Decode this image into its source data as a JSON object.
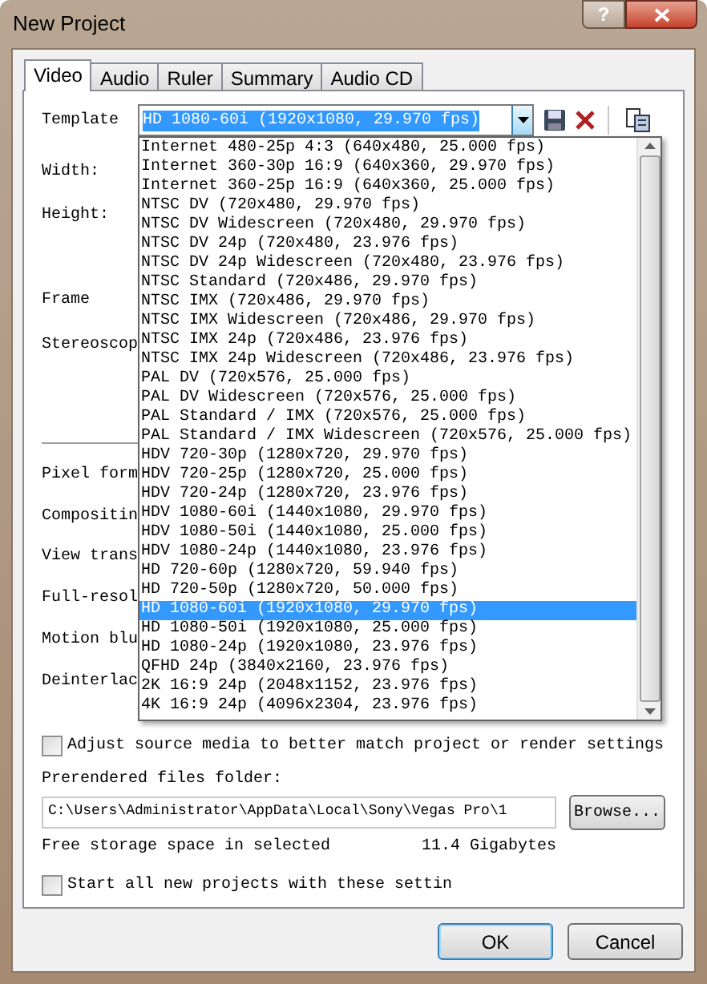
{
  "window": {
    "title": "New Project",
    "help": "?"
  },
  "tabs": [
    {
      "label": "Video",
      "selected": true
    },
    {
      "label": "Audio",
      "selected": false
    },
    {
      "label": "Ruler",
      "selected": false
    },
    {
      "label": "Summary",
      "selected": false
    },
    {
      "label": "Audio CD",
      "selected": false
    }
  ],
  "template": {
    "label": "Template",
    "value": "HD 1080-60i (1920x1080, 29.970 fps)"
  },
  "form_labels": [
    "Width:",
    "Height:",
    "Frame",
    "Stereoscop",
    "Pixel form",
    "Compositin",
    "View trans",
    "Full-resol",
    "Motion blu",
    "Deinterlac"
  ],
  "dropdown_items": [
    {
      "label": "Internet 480-25p 4:3 (640x480, 25.000 fps)",
      "selected": false
    },
    {
      "label": "Internet 360-30p 16:9 (640x360, 29.970 fps)",
      "selected": false
    },
    {
      "label": "Internet 360-25p 16:9 (640x360, 25.000 fps)",
      "selected": false
    },
    {
      "label": "NTSC DV (720x480, 29.970 fps)",
      "selected": false
    },
    {
      "label": "NTSC DV Widescreen (720x480, 29.970 fps)",
      "selected": false
    },
    {
      "label": "NTSC DV 24p (720x480, 23.976 fps)",
      "selected": false
    },
    {
      "label": "NTSC DV 24p Widescreen (720x480, 23.976 fps)",
      "selected": false
    },
    {
      "label": "NTSC Standard (720x486, 29.970 fps)",
      "selected": false
    },
    {
      "label": "NTSC IMX (720x486, 29.970 fps)",
      "selected": false
    },
    {
      "label": "NTSC IMX Widescreen (720x486, 29.970 fps)",
      "selected": false
    },
    {
      "label": "NTSC IMX 24p (720x486, 23.976 fps)",
      "selected": false
    },
    {
      "label": "NTSC IMX 24p Widescreen (720x486, 23.976 fps)",
      "selected": false
    },
    {
      "label": "PAL DV (720x576, 25.000 fps)",
      "selected": false
    },
    {
      "label": "PAL DV Widescreen (720x576, 25.000 fps)",
      "selected": false
    },
    {
      "label": "PAL Standard / IMX (720x576, 25.000 fps)",
      "selected": false
    },
    {
      "label": "PAL Standard / IMX Widescreen (720x576, 25.000 fps)",
      "selected": false
    },
    {
      "label": "HDV 720-30p (1280x720, 29.970 fps)",
      "selected": false
    },
    {
      "label": "HDV 720-25p (1280x720, 25.000 fps)",
      "selected": false
    },
    {
      "label": "HDV 720-24p (1280x720, 23.976 fps)",
      "selected": false
    },
    {
      "label": "HDV 1080-60i (1440x1080, 29.970 fps)",
      "selected": false
    },
    {
      "label": "HDV 1080-50i (1440x1080, 25.000 fps)",
      "selected": false
    },
    {
      "label": "HDV 1080-24p (1440x1080, 23.976 fps)",
      "selected": false
    },
    {
      "label": "HD 720-60p (1280x720, 59.940 fps)",
      "selected": false
    },
    {
      "label": "HD 720-50p (1280x720, 50.000 fps)",
      "selected": false
    },
    {
      "label": "HD 1080-60i (1920x1080, 29.970 fps)",
      "selected": true
    },
    {
      "label": "HD 1080-50i (1920x1080, 25.000 fps)",
      "selected": false
    },
    {
      "label": "HD 1080-24p (1920x1080, 23.976 fps)",
      "selected": false
    },
    {
      "label": "QFHD 24p (3840x2160, 23.976 fps)",
      "selected": false
    },
    {
      "label": "2K 16:9 24p (2048x1152, 23.976 fps)",
      "selected": false
    },
    {
      "label": "4K 16:9 24p (4096x2304, 23.976 fps)",
      "selected": false
    }
  ],
  "adjust_checkbox": {
    "label": "Adjust source media to better match project or render settings",
    "checked": false
  },
  "prerendered": {
    "label": "Prerendered files folder:",
    "path": "C:\\Users\\Administrator\\AppData\\Local\\Sony\\Vegas Pro\\1",
    "browse": "Browse..."
  },
  "storage": {
    "label": "Free storage space in selected",
    "value": "11.4 Gigabytes"
  },
  "start_checkbox": {
    "label": "Start all new projects with these settin",
    "checked": false
  },
  "buttons": [
    "OK",
    "Cancel"
  ]
}
